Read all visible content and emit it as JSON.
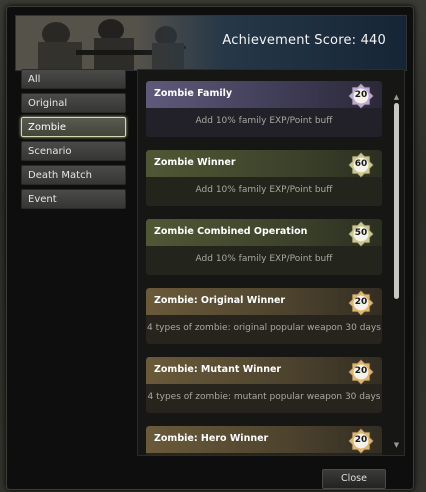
{
  "header": {
    "score_text": "Achievement Score: 440"
  },
  "sidebar": {
    "items": [
      {
        "label": "All",
        "active": false
      },
      {
        "label": "Original",
        "active": false
      },
      {
        "label": "Zombie",
        "active": true
      },
      {
        "label": "Scenario",
        "active": false
      },
      {
        "label": "Death Match",
        "active": false
      },
      {
        "label": "Event",
        "active": false
      }
    ]
  },
  "achievements": [
    {
      "title": "Zombie Family",
      "points": "20",
      "desc": "Add 10% family EXP/Point buff",
      "theme": "purple",
      "badge_color": "#b9a8d8"
    },
    {
      "title": "Zombie Winner",
      "points": "60",
      "desc": "Add 10% family EXP/Point buff",
      "theme": "green",
      "badge_color": "#c9c88a"
    },
    {
      "title": "Zombie Combined Operation",
      "points": "50",
      "desc": "Add 10% family EXP/Point buff",
      "theme": "green",
      "badge_color": "#c9c88a"
    },
    {
      "title": "Zombie: Original Winner",
      "points": "20",
      "desc": "4 types of zombie: original popular weapon 30 days",
      "theme": "gold",
      "badge_color": "#e0b46a"
    },
    {
      "title": "Zombie: Mutant Winner",
      "points": "20",
      "desc": "4 types of zombie: mutant popular weapon 30 days",
      "theme": "gold",
      "badge_color": "#e0b46a"
    },
    {
      "title": "Zombie: Hero Winner",
      "points": "20",
      "desc": "",
      "theme": "gold",
      "badge_color": "#e0b46a"
    }
  ],
  "footer": {
    "close_label": "Close"
  }
}
